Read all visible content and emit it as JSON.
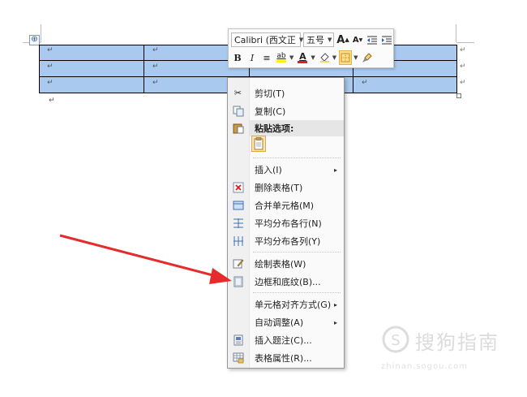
{
  "table": {
    "move_handle": "⊕",
    "paragraph_mark": "↵",
    "rows": [
      [
        "↵",
        "↵",
        "↵",
        "↵"
      ],
      [
        "↵",
        "↵",
        "↵",
        "↵"
      ],
      [
        "↵",
        "↵",
        "↵",
        "↵"
      ]
    ],
    "row_end_marks": [
      "↵",
      "↵",
      "↵"
    ],
    "selection_color": "#a9c9ee"
  },
  "mini_toolbar": {
    "font_name": "Calibri (西文正",
    "font_size": "五号",
    "grow_font": "A",
    "shrink_font": "A",
    "bold": "B",
    "italic": "I",
    "align": "≡",
    "highlight": "ab",
    "font_color": "A",
    "font_color_value": "#e02020",
    "shading_color_value": "#f5d76e"
  },
  "context_menu": {
    "items": [
      {
        "label": "剪切(T)",
        "icon": "scissors-icon"
      },
      {
        "label": "复制(C)",
        "icon": "copy-icon"
      },
      {
        "label": "粘贴选项:",
        "icon": "clipboard-icon"
      },
      {
        "label": "插入(I)",
        "icon": ""
      },
      {
        "label": "删除表格(T)",
        "icon": "delete-table-icon"
      },
      {
        "label": "合并单元格(M)",
        "icon": "merge-cells-icon"
      },
      {
        "label": "平均分布各行(N)",
        "icon": "distribute-rows-icon"
      },
      {
        "label": "平均分布各列(Y)",
        "icon": "distribute-columns-icon"
      },
      {
        "label": "绘制表格(W)",
        "icon": "draw-table-icon"
      },
      {
        "label": "边框和底纹(B)...",
        "icon": "borders-shading-icon"
      },
      {
        "label": "单元格对齐方式(G)",
        "icon": ""
      },
      {
        "label": "自动调整(A)",
        "icon": ""
      },
      {
        "label": "插入题注(C)...",
        "icon": "insert-caption-icon"
      },
      {
        "label": "表格属性(R)...",
        "icon": "table-properties-icon"
      }
    ],
    "submenu_arrow": "▸"
  },
  "annotation": {
    "arrow_color": "#e52b2b"
  },
  "watermark": {
    "text": "搜狗指南",
    "url": "zhinan.sogou.com"
  }
}
